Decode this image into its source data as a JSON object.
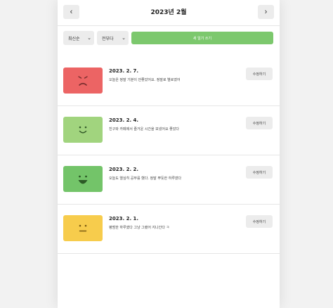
{
  "header": {
    "title": "2023년 2월",
    "prev_label": "‹",
    "next_label": "›"
  },
  "toolbar": {
    "sort_value": "최신순",
    "filter_value": "전부다",
    "new_button_label": "새 일기 쓰기"
  },
  "entries": [
    {
      "date": "2023. 2. 7.",
      "content": "오늘은 정말 기분이 안좋았어요. 정말로 별로였어",
      "edit_label": "수정하기",
      "emotion": "angry",
      "color": "#ec6464"
    },
    {
      "date": "2023. 2. 4.",
      "content": "친구와 카페에서 즐거운 시간을 보냈어요 좋았다",
      "edit_label": "수정하기",
      "emotion": "happy",
      "color": "#a1d47e"
    },
    {
      "date": "2023. 2. 2.",
      "content": "오늘도 열심히 공부를 했다. 정말 뿌듯한 하루였다",
      "edit_label": "수정하기",
      "emotion": "very-happy",
      "color": "#73c469"
    },
    {
      "date": "2023. 2. 1.",
      "content": "평범한 하루였다 그냥 그랬어 지나간다 ㅋ",
      "edit_label": "수정하기",
      "emotion": "neutral",
      "color": "#f7cc4c"
    }
  ]
}
